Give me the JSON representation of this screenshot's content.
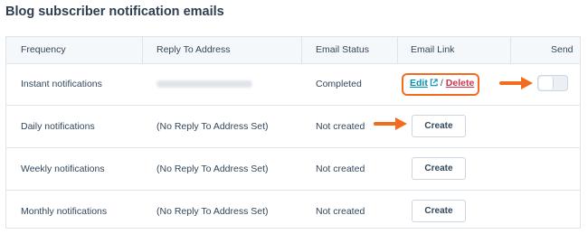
{
  "page_title": "Blog subscriber notification emails",
  "table": {
    "columns": [
      "Frequency",
      "Reply To Address",
      "Email Status",
      "Email Link",
      "Send"
    ],
    "rows": [
      {
        "frequency": "Instant notifications",
        "reply_to": "",
        "status": "Completed",
        "edit_label": "Edit",
        "separator": "/",
        "delete_label": "Delete"
      },
      {
        "frequency": "Daily notifications",
        "reply_to": "(No Reply To Address Set)",
        "status": "Not created",
        "create_label": "Create"
      },
      {
        "frequency": "Weekly notifications",
        "reply_to": "(No Reply To Address Set)",
        "status": "Not created",
        "create_label": "Create"
      },
      {
        "frequency": "Monthly notifications",
        "reply_to": "(No Reply To Address Set)",
        "status": "Not created",
        "create_label": "Create"
      }
    ]
  },
  "icons": {
    "external_link": "external-link-icon",
    "annotation_arrow": "arrow-right-icon"
  },
  "colors": {
    "accent_orange": "#f36b1c",
    "edit_link": "#0091ae",
    "delete_link": "#d0334a",
    "header_bg": "#f5f8fa",
    "border": "#dfe3eb"
  },
  "send_toggle_on": false
}
